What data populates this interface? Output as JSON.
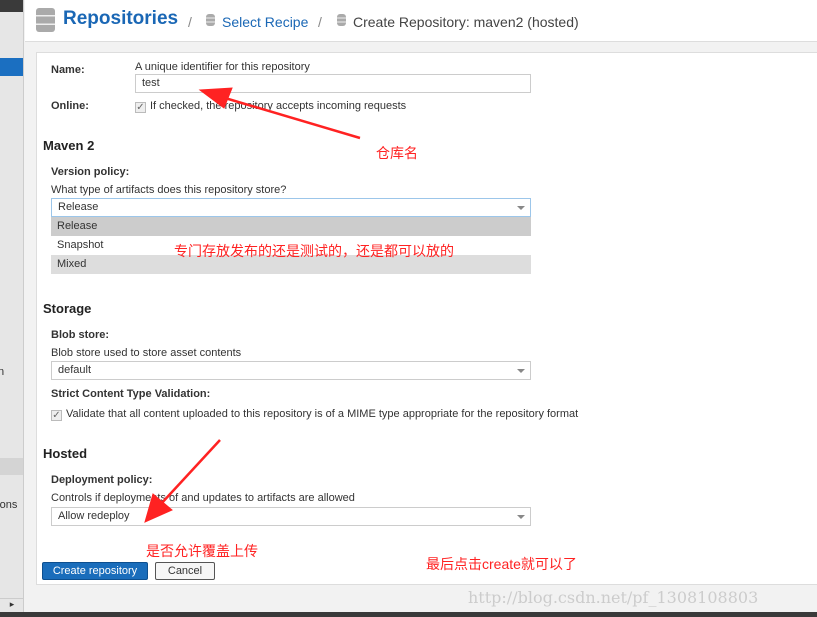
{
  "sidebar": {
    "partial_item_1": "n",
    "partial_item_2": "ations",
    "scroll_arrow": "▸"
  },
  "header": {
    "title": "Repositories",
    "sep": "/",
    "crumb1": "Select Recipe",
    "crumb2": "Create Repository: maven2 (hosted)"
  },
  "form": {
    "name_label": "Name:",
    "name_help": "A unique identifier for this repository",
    "name_value": "test",
    "online_label": "Online:",
    "online_help": "If checked, the repository accepts incoming requests",
    "online_checked": true,
    "maven_section": "Maven 2",
    "version_label": "Version policy:",
    "version_help": "What type of artifacts does this repository store?",
    "version_value": "Release",
    "version_options": [
      "Release",
      "Snapshot",
      "Mixed"
    ],
    "storage_section": "Storage",
    "blob_label": "Blob store:",
    "blob_help": "Blob store used to store asset contents",
    "blob_value": "default",
    "strict_label": "Strict Content Type Validation:",
    "strict_help": "Validate that all content uploaded to this repository is of a MIME type appropriate for the repository format",
    "strict_checked": true,
    "hosted_section": "Hosted",
    "deploy_label": "Deployment policy:",
    "deploy_help": "Controls if deployments of and updates to artifacts are allowed",
    "deploy_value": "Allow redeploy",
    "create_label": "Create repository",
    "cancel_label": "Cancel"
  },
  "annotations": {
    "name_note": "仓库名",
    "policy_note": "专门存放发布的还是测试的，还是都可以放的",
    "deploy_note": "是否允许覆盖上传",
    "final_note": "最后点击create就可以了",
    "color": "#ff2222"
  },
  "watermark": "http://blog.csdn.net/pf_1308108803"
}
